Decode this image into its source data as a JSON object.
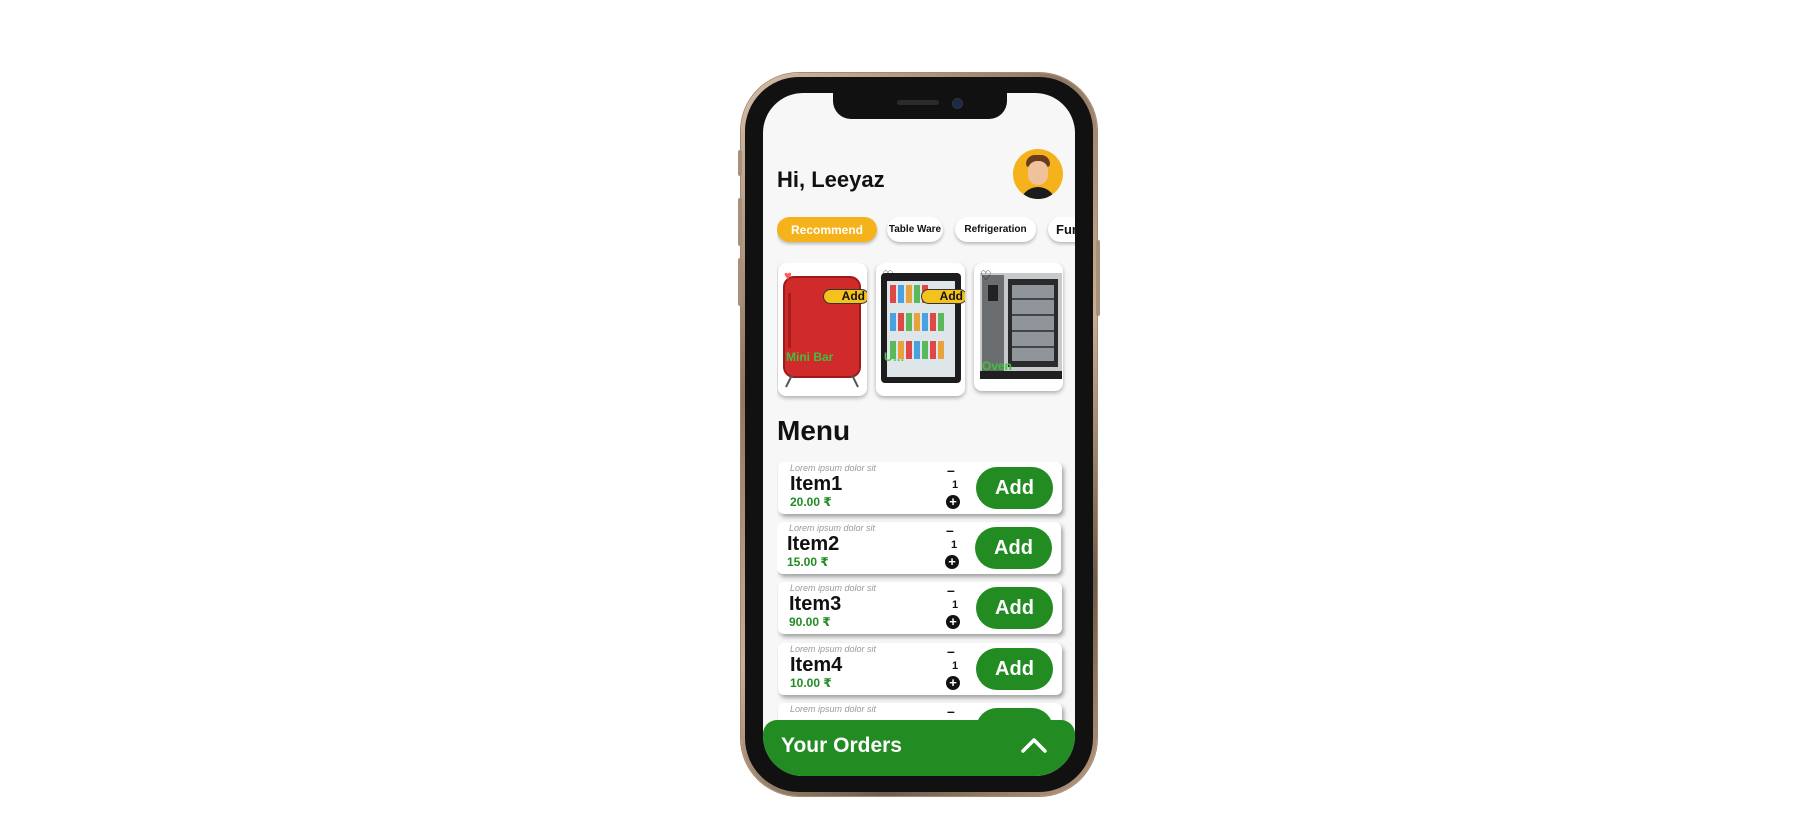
{
  "header": {
    "greeting": "Hi, Leeyaz"
  },
  "categories": [
    {
      "label": "Recommend",
      "active": true
    },
    {
      "label": "Table Ware",
      "active": false
    },
    {
      "label": "Refrigeration",
      "active": false
    },
    {
      "label": "Fur",
      "active": false
    }
  ],
  "featured": [
    {
      "name": "Mini Bar",
      "add_label": "Add",
      "favorited": true
    },
    {
      "name": "U…",
      "add_label": "Add",
      "favorited": false
    },
    {
      "name": "Oven",
      "add_label": "",
      "favorited": false
    }
  ],
  "menu": {
    "title": "Menu",
    "items": [
      {
        "desc": "Lorem ipsum dolor sit",
        "name": "Item1",
        "price": "20.00 ₹",
        "minus": "–",
        "qty": "1",
        "plus": "+",
        "add_label": "Add"
      },
      {
        "desc": "Lorem ipsum dolor sit",
        "name": "Item2",
        "price": "15.00 ₹",
        "minus": "–",
        "qty": "1",
        "plus": "+",
        "add_label": "Add"
      },
      {
        "desc": "Lorem ipsum dolor sit",
        "name": "Item3",
        "price": "90.00 ₹",
        "minus": "–",
        "qty": "1",
        "plus": "+",
        "add_label": "Add"
      },
      {
        "desc": "Lorem ipsum dolor sit",
        "name": "Item4",
        "price": "10.00 ₹",
        "minus": "–",
        "qty": "1",
        "plus": "+",
        "add_label": "Add"
      },
      {
        "desc": "Lorem ipsum dolor sit",
        "name": "",
        "price": "",
        "minus": "–",
        "qty": "",
        "plus": "",
        "add_label": ""
      }
    ]
  },
  "orders_bar": {
    "label": "Your Orders"
  },
  "colors": {
    "accent_green": "#228B22",
    "accent_yellow": "#f5b21b",
    "featured_name_green": "#3ec13e"
  }
}
